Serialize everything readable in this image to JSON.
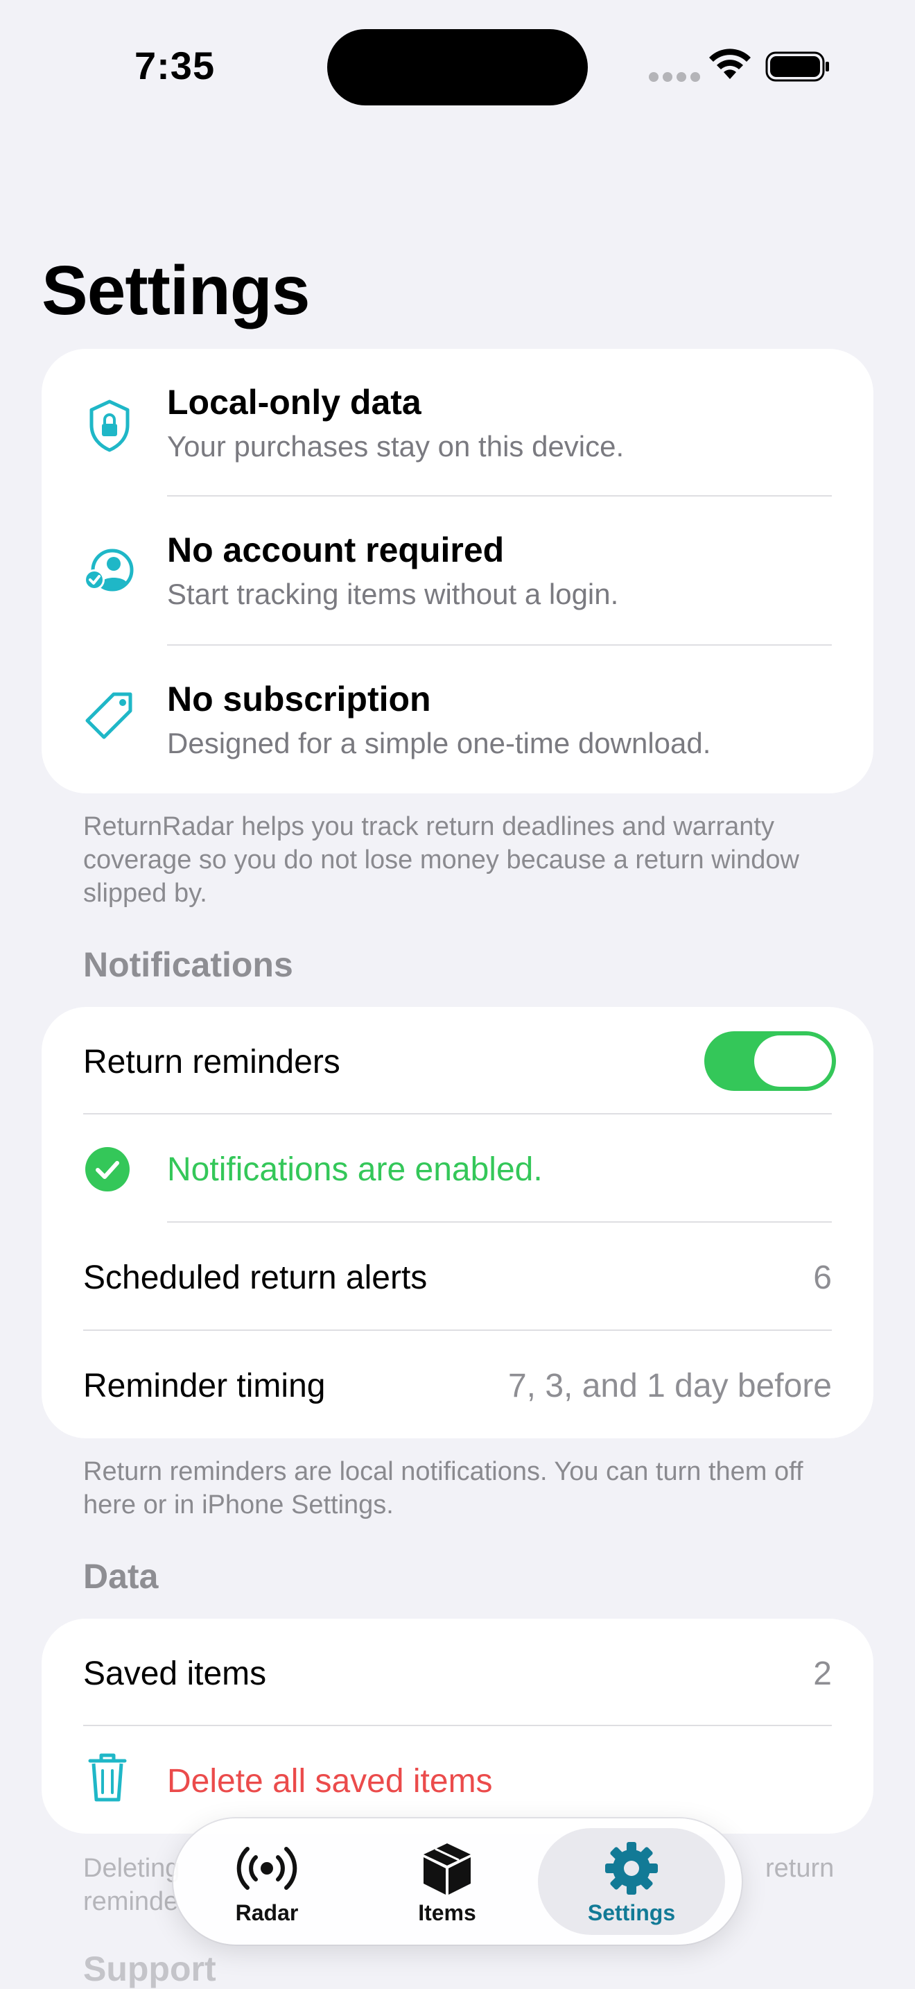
{
  "status": {
    "time": "7:35"
  },
  "title": "Settings",
  "features": [
    {
      "title": "Local-only data",
      "subtitle": "Your purchases stay on this device.",
      "icon": "lock-shield-icon"
    },
    {
      "title": "No account required",
      "subtitle": "Start tracking items without a login.",
      "icon": "person-check-icon"
    },
    {
      "title": "No subscription",
      "subtitle": "Designed for a simple one-time download.",
      "icon": "tag-icon"
    }
  ],
  "about_footnote": "ReturnRadar helps you track return deadlines and warranty coverage so you do not lose money because a return window slipped by.",
  "notifications": {
    "header": "Notifications",
    "return_reminders_label": "Return reminders",
    "return_reminders_on": true,
    "enabled_message": "Notifications are enabled.",
    "scheduled_label": "Scheduled return alerts",
    "scheduled_value": "6",
    "timing_label": "Reminder timing",
    "timing_value": "7, 3, and 1 day before",
    "footnote": "Return reminders are local notifications. You can turn them off here or in iPhone Settings."
  },
  "data_section": {
    "header": "Data",
    "saved_label": "Saved items",
    "saved_value": "2",
    "delete_label": "Delete all saved items",
    "footnote_partial_1": "Deleting",
    "footnote_partial_2": "return",
    "footnote_partial_3": "reminde"
  },
  "support_header": "Support",
  "tabs": [
    {
      "label": "Radar",
      "icon": "antenna-radiowaves-icon",
      "active": false
    },
    {
      "label": "Items",
      "icon": "shipping-box-icon",
      "active": false
    },
    {
      "label": "Settings",
      "icon": "gear-icon",
      "active": true
    }
  ],
  "colors": {
    "accent": "#1fb7c7",
    "green": "#34c759",
    "destructive": "#eb4b4b",
    "active_tab": "#127a96"
  }
}
